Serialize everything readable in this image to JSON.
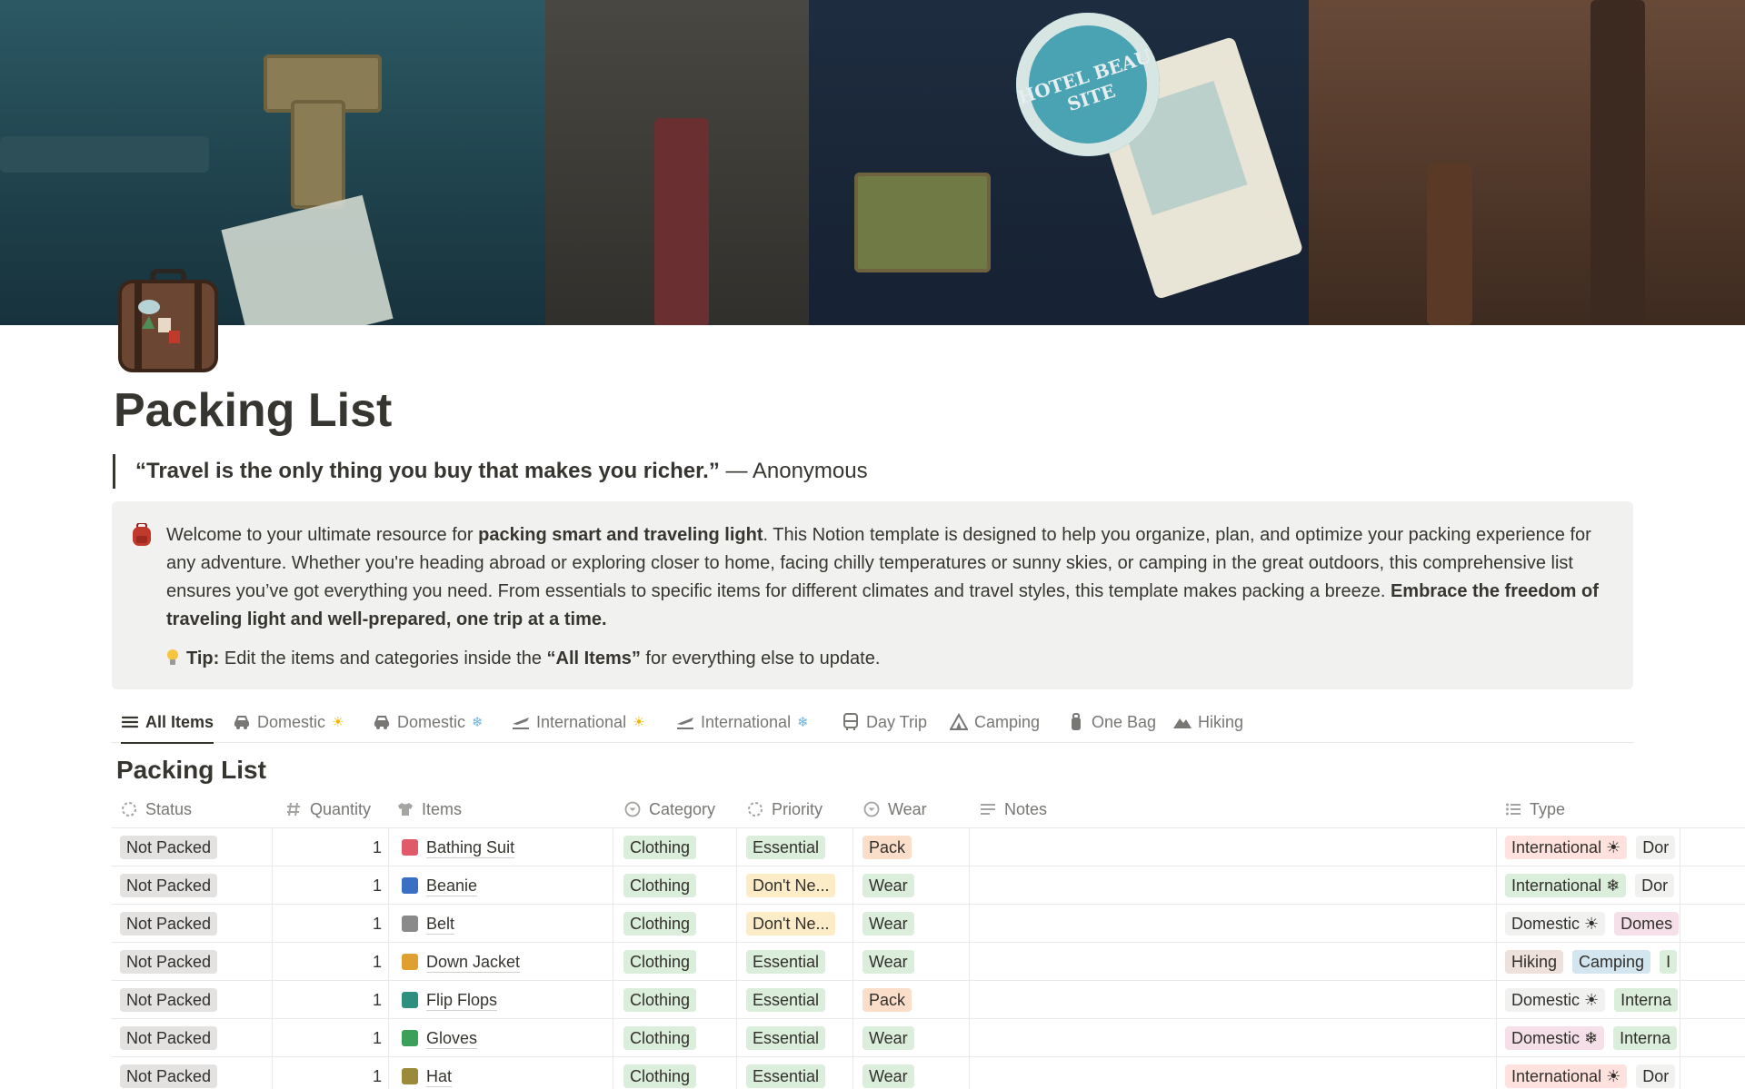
{
  "page": {
    "title": "Packing List",
    "quote": {
      "text": "“Travel is the only thing you buy that makes you richer.”",
      "author": "— Anonymous"
    }
  },
  "callout": {
    "icon": "backpack-icon",
    "text_1": "Welcome to your ultimate resource for ",
    "bold_1": "packing smart and traveling light",
    "text_2": ". This Notion template is designed to help you organize, plan, and optimize your packing experience for any adventure. Whether you're heading abroad or exploring closer to home, facing chilly temperatures or sunny skies, or camping in the great outdoors, this comprehensive list ensures you’ve got everything you need. From essentials to specific items for different climates and travel styles, this template makes packing a breeze. ",
    "bold_2": "Embrace the freedom of traveling light and well-prepared, one trip at a time.",
    "tip_label": "Tip:",
    "tip_text_1": " Edit the items and categories inside the ",
    "tip_bold": "“All Items”",
    "tip_text_2": " for everything else to update."
  },
  "tabs": [
    {
      "label": "All Items",
      "icon": "list-icon",
      "emoji": "",
      "active": true
    },
    {
      "label": "Domestic",
      "icon": "car-icon",
      "emoji": "☀",
      "active": false
    },
    {
      "label": "Domestic",
      "icon": "car-icon",
      "emoji": "❄",
      "active": false
    },
    {
      "label": "International",
      "icon": "airplane-icon",
      "emoji": "☀",
      "active": false
    },
    {
      "label": "International",
      "icon": "airplane-icon",
      "emoji": "❄",
      "active": false
    },
    {
      "label": "Day Trip",
      "icon": "bus-icon",
      "emoji": "",
      "active": false
    },
    {
      "label": "Camping",
      "icon": "tent-icon",
      "emoji": "",
      "active": false
    },
    {
      "label": "One Bag",
      "icon": "bag-icon",
      "emoji": "",
      "active": false
    },
    {
      "label": "Hiking",
      "icon": "mountain-icon",
      "emoji": "",
      "active": false
    }
  ],
  "database": {
    "title": "Packing List",
    "columns": [
      {
        "label": "Status",
        "icon": "status-icon"
      },
      {
        "label": "Quantity",
        "icon": "number-icon"
      },
      {
        "label": "Items",
        "icon": "shirt-icon"
      },
      {
        "label": "Category",
        "icon": "select-icon"
      },
      {
        "label": "Priority",
        "icon": "status-icon"
      },
      {
        "label": "Wear",
        "icon": "select-icon"
      },
      {
        "label": "Notes",
        "icon": "text-icon"
      },
      {
        "label": "Type",
        "icon": "multi-select-icon"
      }
    ],
    "rows": [
      {
        "status": "Not Packed",
        "quantity": "1",
        "item": "Bathing Suit",
        "item_icon": "swimsuit-icon",
        "category": "Clothing",
        "priority": "Essential",
        "wear": "Pack",
        "notes": "",
        "types": [
          "International ☀",
          "Dor"
        ]
      },
      {
        "status": "Not Packed",
        "quantity": "1",
        "item": "Beanie",
        "item_icon": "beanie-icon",
        "category": "Clothing",
        "priority": "Don't Ne...",
        "wear": "Wear",
        "notes": "",
        "types": [
          "International ❄",
          "Dor"
        ]
      },
      {
        "status": "Not Packed",
        "quantity": "1",
        "item": "Belt",
        "item_icon": "belt-icon",
        "category": "Clothing",
        "priority": "Don't Ne...",
        "wear": "Wear",
        "notes": "",
        "types": [
          "Domestic ☀",
          "Domes"
        ]
      },
      {
        "status": "Not Packed",
        "quantity": "1",
        "item": "Down Jacket",
        "item_icon": "jacket-icon",
        "category": "Clothing",
        "priority": "Essential",
        "wear": "Wear",
        "notes": "",
        "types": [
          "Hiking",
          "Camping",
          "I"
        ]
      },
      {
        "status": "Not Packed",
        "quantity": "1",
        "item": "Flip Flops",
        "item_icon": "flip-flops-icon",
        "category": "Clothing",
        "priority": "Essential",
        "wear": "Pack",
        "notes": "",
        "types": [
          "Domestic ☀",
          "Interna"
        ]
      },
      {
        "status": "Not Packed",
        "quantity": "1",
        "item": "Gloves",
        "item_icon": "gloves-icon",
        "category": "Clothing",
        "priority": "Essential",
        "wear": "Wear",
        "notes": "",
        "types": [
          "Domestic ❄",
          "Interna"
        ]
      },
      {
        "status": "Not Packed",
        "quantity": "1",
        "item": "Hat",
        "item_icon": "hat-icon",
        "category": "Clothing",
        "priority": "Essential",
        "wear": "Wear",
        "notes": "",
        "types": [
          "International ☀",
          "Dor"
        ]
      }
    ]
  },
  "colors": {
    "status_bg": "#e3e2e0",
    "category_bg": "#dbeddb",
    "essential_bg": "#dbeddb",
    "dont_need_bg": "#fdecc8",
    "pack_bg": "#fadec9",
    "wear_bg": "#dbeddb",
    "type_international_sun": "#ffe2dd",
    "type_international_snow": "#dbeddb",
    "type_domestic_sun": "#f1f1ef",
    "type_domestic_snow": "#f5e0e9",
    "type_hiking": "#eee0da",
    "type_camping": "#d3e5ef",
    "type_default": "#f1f1ef"
  }
}
